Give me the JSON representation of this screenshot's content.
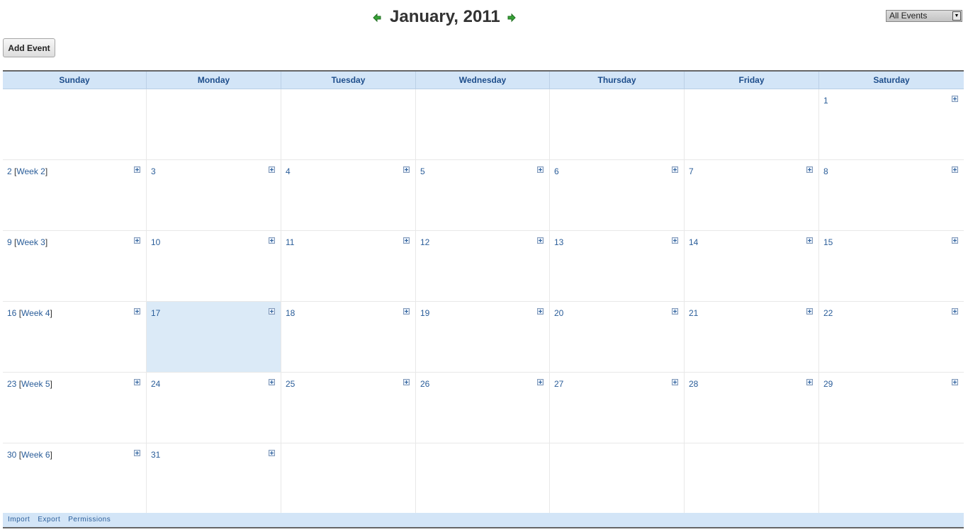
{
  "header": {
    "title": "January, 2011",
    "prev_icon": "arrow-left-icon",
    "next_icon": "arrow-right-icon",
    "filter": {
      "selected": "All Events"
    },
    "add_event_label": "Add Event"
  },
  "day_headers": [
    "Sunday",
    "Monday",
    "Tuesday",
    "Wednesday",
    "Thursday",
    "Friday",
    "Saturday"
  ],
  "weeks": [
    {
      "days": [
        "",
        "",
        "",
        "",
        "",
        "",
        "1"
      ]
    },
    {
      "week_label": "Week 2",
      "days": [
        "2",
        "3",
        "4",
        "5",
        "6",
        "7",
        "8"
      ]
    },
    {
      "week_label": "Week 3",
      "days": [
        "9",
        "10",
        "11",
        "12",
        "13",
        "14",
        "15"
      ]
    },
    {
      "week_label": "Week 4",
      "days": [
        "16",
        "17",
        "18",
        "19",
        "20",
        "21",
        "22"
      ]
    },
    {
      "week_label": "Week 5",
      "days": [
        "23",
        "24",
        "25",
        "26",
        "27",
        "28",
        "29"
      ]
    },
    {
      "week_label": "Week 6",
      "days": [
        "30",
        "31",
        "",
        "",
        "",
        "",
        ""
      ]
    }
  ],
  "today": "17",
  "footer": {
    "links": [
      "Import",
      "Export",
      "Permissions"
    ]
  },
  "colors": {
    "accent": "#2a5d99",
    "header_bg": "#d3e5f7",
    "today_bg": "#dbeaf7",
    "nav_arrow": "#2f9a2f"
  }
}
